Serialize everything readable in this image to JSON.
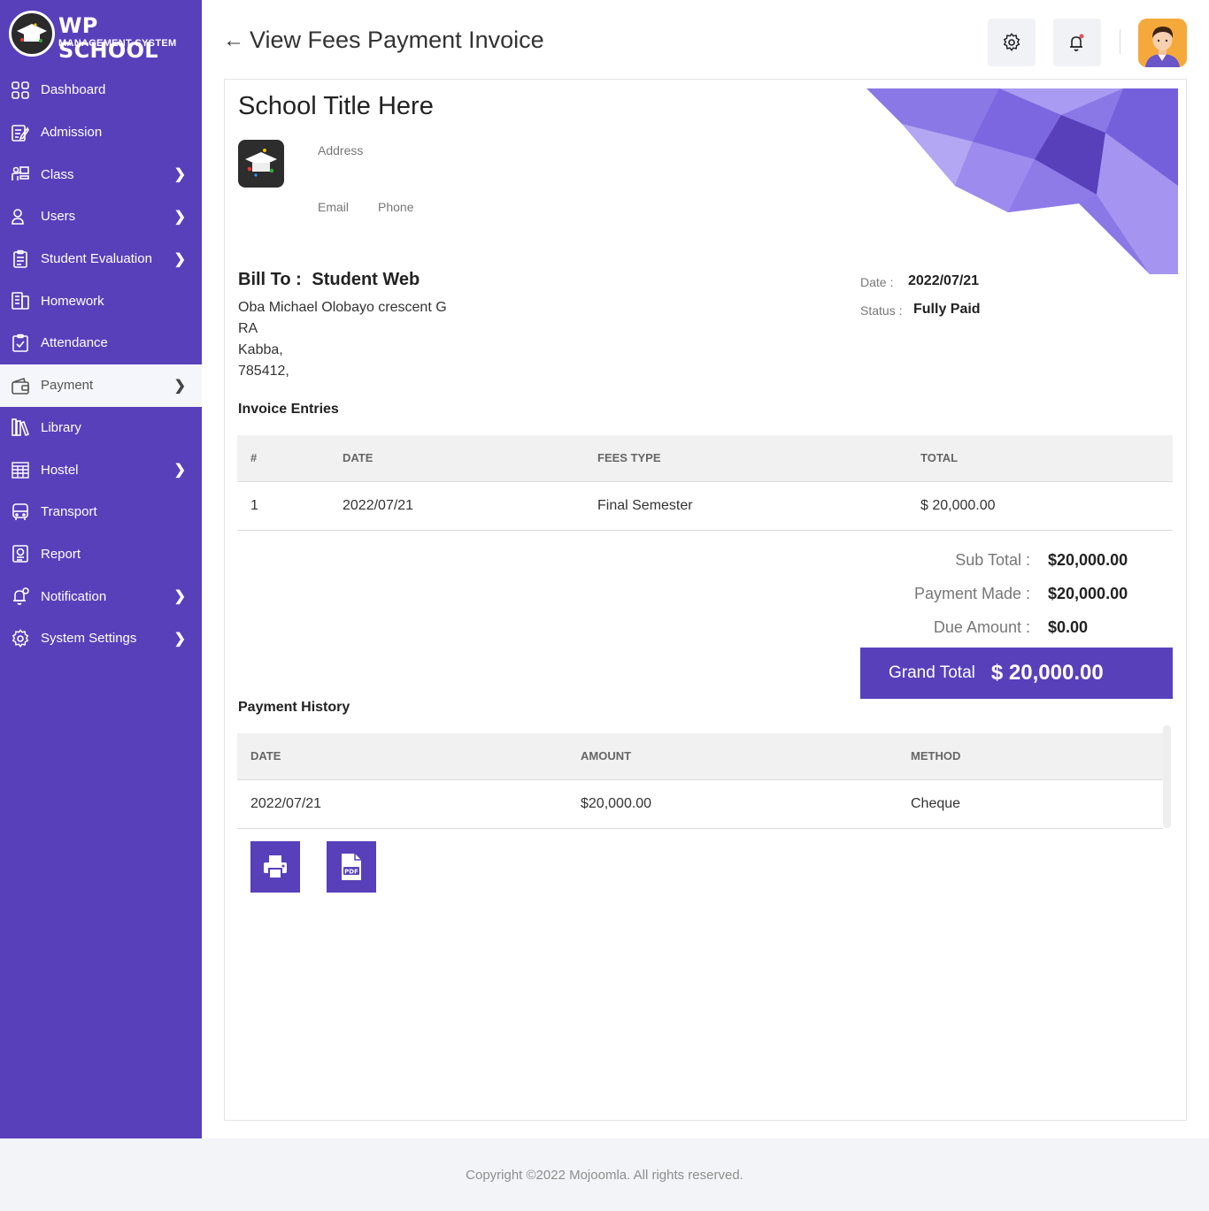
{
  "brand": {
    "title": "WP SCHOOL",
    "subtitle": "MANAGEMENT SYSTEM"
  },
  "sidebar": {
    "items": [
      {
        "label": "Dashboard",
        "icon": "dashboard-icon",
        "chevron": false
      },
      {
        "label": "Admission",
        "icon": "admission-icon",
        "chevron": false
      },
      {
        "label": "Class",
        "icon": "class-icon",
        "chevron": true
      },
      {
        "label": "Users",
        "icon": "users-icon",
        "chevron": true
      },
      {
        "label": "Student Evaluation",
        "icon": "evaluation-icon",
        "chevron": true
      },
      {
        "label": "Homework",
        "icon": "homework-icon",
        "chevron": false
      },
      {
        "label": "Attendance",
        "icon": "attendance-icon",
        "chevron": false
      },
      {
        "label": "Payment",
        "icon": "wallet-icon",
        "chevron": true,
        "active": true
      },
      {
        "label": "Library",
        "icon": "library-icon",
        "chevron": false
      },
      {
        "label": "Hostel",
        "icon": "hostel-icon",
        "chevron": true
      },
      {
        "label": "Transport",
        "icon": "bus-icon",
        "chevron": false
      },
      {
        "label": "Report",
        "icon": "report-icon",
        "chevron": false
      },
      {
        "label": "Notification",
        "icon": "notification-icon",
        "chevron": true
      },
      {
        "label": "System Settings",
        "icon": "settings-icon",
        "chevron": true
      }
    ]
  },
  "header": {
    "title": "View Fees Payment Invoice",
    "back": "←"
  },
  "invoice": {
    "school_title": "School Title Here",
    "address_label": "Address",
    "email_label": "Email",
    "phone_label": "Phone",
    "bill_to_label": "Bill To :",
    "bill_to_name": "Student Web",
    "address_lines": [
      "Oba Michael Olobayo crescent G",
      "RA",
      "Kabba,",
      "785412,"
    ],
    "date_label": "Date :",
    "date_value": "2022/07/21",
    "status_label": "Status :",
    "status_value": "Fully Paid",
    "entries_title": "Invoice Entries",
    "entries_headers": [
      "#",
      "DATE",
      "FEES TYPE",
      "TOTAL"
    ],
    "entries": [
      {
        "num": "1",
        "date": "2022/07/21",
        "fees_type": "Final Semester",
        "total": "$ 20,000.00"
      }
    ],
    "sub_total_label": "Sub Total :",
    "sub_total_value": "$20,000.00",
    "payment_made_label": "Payment Made :",
    "payment_made_value": "$20,000.00",
    "due_label": "Due Amount :",
    "due_value": "$0.00",
    "grand_label": "Grand Total",
    "grand_value": "$ 20,000.00",
    "history_title": "Payment History",
    "history_headers": [
      "DATE",
      "AMOUNT",
      "METHOD"
    ],
    "history": [
      {
        "date": "2022/07/21",
        "amount": "$20,000.00",
        "method": "Cheque"
      }
    ]
  },
  "colors": {
    "brand": "#5840bb",
    "active_bg": "#f5f6fb"
  },
  "footer": {
    "text": "Copyright ©2022 Mojoomla. All rights reserved."
  }
}
